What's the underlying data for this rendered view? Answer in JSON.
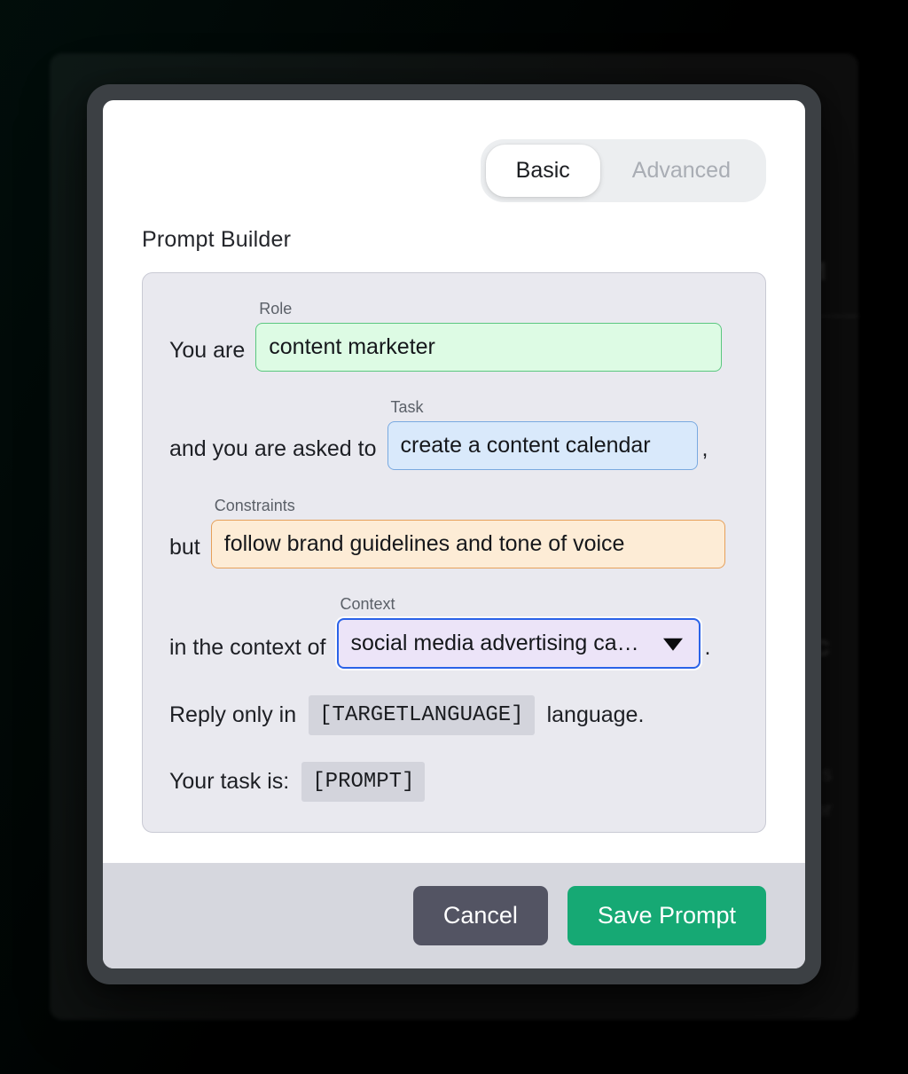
{
  "background": {
    "ghost_texts": [
      "M",
      "nc",
      "in",
      "a s",
      "or"
    ]
  },
  "dialog": {
    "tabs": [
      {
        "label": "Basic",
        "active": true
      },
      {
        "label": "Advanced",
        "active": false
      }
    ],
    "title": "Prompt Builder",
    "fields": {
      "role": {
        "lead": "You are",
        "label": "Role",
        "value": "content marketer",
        "placeholder": "Role",
        "accent": "#5bc77f",
        "fill": "#ddfbe4"
      },
      "task": {
        "lead": "and you are asked to",
        "label": "Task",
        "value": "create a content calendar",
        "placeholder": "Task",
        "trailing_punctuation": ",",
        "accent": "#79a9e0",
        "fill": "#d9e9fb"
      },
      "constraints": {
        "lead": "but",
        "label": "Constraints",
        "value": "follow brand guidelines and tone of voice",
        "placeholder": "Constraints",
        "accent": "#e6a05a",
        "fill": "#fdecd6"
      },
      "context": {
        "lead": "in the context of",
        "label": "Context",
        "value": "social media advertising campaign",
        "trailing_punctuation": ".",
        "accent": "#2a62e8",
        "fill": "#ece4f8",
        "caret_icon": "chevron-down-icon",
        "options": [
          "social media advertising campaign"
        ]
      }
    },
    "static_lines": {
      "language": {
        "lead": "Reply only in",
        "token": "[TARGETLANGUAGE]",
        "tail": "language."
      },
      "prompt": {
        "lead": "Your task is:",
        "token": "[PROMPT]"
      }
    },
    "footer": {
      "cancel_label": "Cancel",
      "save_label": "Save Prompt",
      "cancel_color": "#535463",
      "save_color": "#16a974"
    }
  }
}
